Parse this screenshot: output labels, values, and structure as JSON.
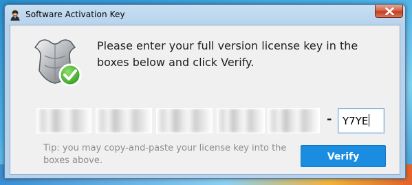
{
  "window": {
    "title": "Software Activation Key",
    "title_icon": "user-avatar-icon",
    "close_icon": "close-icon"
  },
  "content": {
    "hero_icon": "shield-armor-check-icon",
    "headline": "Please enter your full version license key in the boxes below and click Verify.",
    "key_fields": [
      {
        "value": "",
        "obscured": true
      },
      {
        "value": "",
        "obscured": true
      },
      {
        "value": "",
        "obscured": true
      },
      {
        "value": "",
        "obscured": true
      },
      {
        "value": "",
        "obscured": true
      },
      {
        "value": "Y7YE",
        "obscured": false,
        "focused": true
      }
    ],
    "separator": "-",
    "tip": "Tip: you may copy-and-paste your license key into the boxes above.",
    "verify_label": "Verify"
  },
  "colors": {
    "accent": "#1b8de0",
    "tip_text": "#8c8c8c",
    "close_red": "#c0401f"
  }
}
